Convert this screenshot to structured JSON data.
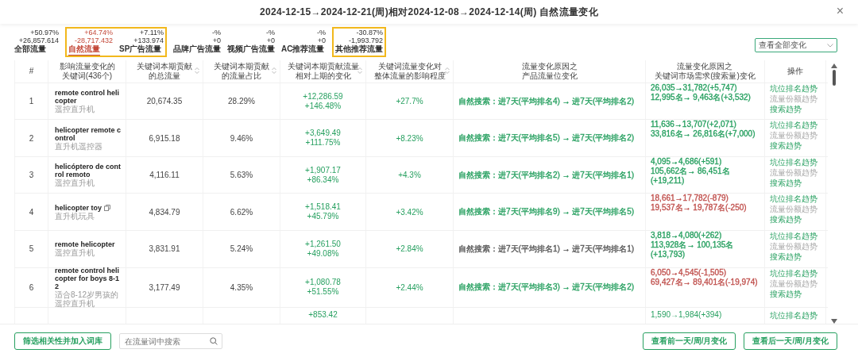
{
  "window": {
    "title": "2024-12-15→2024-12-21(周)相对2024-12-08→2024-12-14(周) 自然流量变化",
    "close": "×"
  },
  "metric_groups": [
    {
      "boxed": false,
      "items": [
        {
          "pct": "+50.97%",
          "abs": "+26,857.614",
          "label": "全部流量",
          "selected": false
        }
      ]
    },
    {
      "boxed": true,
      "items": [
        {
          "pct": "+64.74%",
          "abs": "-28,717.432",
          "label": "自然流量",
          "selected": true
        },
        {
          "pct": "+7.11%",
          "abs": "+133.974",
          "label": "SP广告流量",
          "selected": false
        }
      ]
    },
    {
      "boxed": false,
      "items": [
        {
          "pct": "-%",
          "abs": "+0",
          "label": "品牌广告流量",
          "selected": false
        },
        {
          "pct": "-%",
          "abs": "+0",
          "label": "视频广告流量",
          "selected": false
        },
        {
          "pct": "-%",
          "abs": "+0",
          "label": "AC推荐流量",
          "selected": false
        }
      ]
    },
    {
      "boxed": true,
      "items": [
        {
          "pct": "-30.87%",
          "abs": "-1,993.792",
          "label": "其他推荐流量",
          "selected": false
        }
      ]
    }
  ],
  "filter": {
    "value": "查看全部变化"
  },
  "table": {
    "columns": [
      {
        "lines": [
          "#"
        ],
        "sortable": false
      },
      {
        "lines": [
          "影响流量变化的",
          "关键词(436个)"
        ],
        "sortable": false
      },
      {
        "lines": [
          "关键词本期贡献",
          "的总流量"
        ],
        "sortable": true
      },
      {
        "lines": [
          "关键词本期贡献",
          "的流量占比"
        ],
        "sortable": true
      },
      {
        "lines": [
          "关键词本期贡献流量",
          "相对上期的变化"
        ],
        "sortable": true
      },
      {
        "lines": [
          "关键词流量变化对",
          "整体流量的影响程度"
        ],
        "sortable": true
      },
      {
        "lines": [
          "流量变化原因之",
          "产品流量位变化"
        ],
        "sortable": false
      },
      {
        "lines": [
          "流量变化原因之",
          "关键词市场需求(搜索量)变化"
        ],
        "sortable": false
      },
      {
        "lines": [
          "操作"
        ],
        "sortable": false
      }
    ],
    "rows": [
      {
        "index": "1",
        "keyword": "remote control helicopter",
        "translation": "遥控直升机",
        "copyable": false,
        "total": "20,674.35",
        "share": "28.29%",
        "change": "+12,286.59",
        "change_pct": "+146.48%",
        "impact": "+27.7%",
        "position": {
          "text": "自然搜索：进7天(平均排名4) → 进7天(平均排名2)",
          "color": "#27a060"
        },
        "market": {
          "lines": [
            "26,035→31,782(+5,747)",
            "12,995名→ 9,463名(+3,532)"
          ],
          "color": "#27a060"
        },
        "actions": [
          {
            "label": "坑位排名趋势",
            "disabled": false
          },
          {
            "label": "流量份额趋势",
            "disabled": true
          },
          {
            "label": "搜索趋势",
            "disabled": false
          }
        ]
      },
      {
        "index": "2",
        "keyword": "helicopter remote control",
        "translation": "直升机遥控器",
        "copyable": false,
        "total": "6,915.18",
        "share": "9.46%",
        "change": "+3,649.49",
        "change_pct": "+111.75%",
        "impact": "+8.23%",
        "position": {
          "text": "自然搜索：进7天(平均排名5) → 进7天(平均排名2)",
          "color": "#27a060"
        },
        "market": {
          "lines": [
            "11,636→13,707(+2,071)",
            "33,816名→ 26,816名(+7,000)"
          ],
          "color": "#27a060"
        },
        "actions": [
          {
            "label": "坑位排名趋势",
            "disabled": false
          },
          {
            "label": "流量份额趋势",
            "disabled": true
          },
          {
            "label": "搜索趋势",
            "disabled": false
          }
        ]
      },
      {
        "index": "3",
        "keyword": "helicóptero de control remoto",
        "translation": "遥控直升机",
        "copyable": false,
        "total": "4,116.11",
        "share": "5.63%",
        "change": "+1,907.17",
        "change_pct": "+86.34%",
        "impact": "+4.3%",
        "position": {
          "text": "自然搜索：进7天(平均排名2) → 进7天(平均排名1)",
          "color": "#27a060"
        },
        "market": {
          "lines": [
            "4,095→4,686(+591)",
            "105,662名→ 86,451名(+19,211)"
          ],
          "color": "#27a060"
        },
        "actions": [
          {
            "label": "坑位排名趋势",
            "disabled": false
          },
          {
            "label": "流量份额趋势",
            "disabled": true
          },
          {
            "label": "搜索趋势",
            "disabled": false
          }
        ]
      },
      {
        "index": "4",
        "keyword": "helicopter toy",
        "translation": "直升机玩具",
        "copyable": true,
        "total": "4,834.79",
        "share": "6.62%",
        "change": "+1,518.41",
        "change_pct": "+45.79%",
        "impact": "+3.42%",
        "position": {
          "text": "自然搜索：进7天(平均排名9) → 进7天(平均排名5)",
          "color": "#27a060"
        },
        "market": {
          "lines": [
            "18,661→17,782(-879)",
            "19,537名→ 19,787名(-250)"
          ],
          "color": "#c0504d"
        },
        "actions": [
          {
            "label": "坑位排名趋势",
            "disabled": false
          },
          {
            "label": "流量份额趋势",
            "disabled": true
          },
          {
            "label": "搜索趋势",
            "disabled": false
          }
        ]
      },
      {
        "index": "5",
        "keyword": "remote helicopter",
        "translation": "遥控直升机",
        "copyable": false,
        "total": "3,831.91",
        "share": "5.24%",
        "change": "+1,261.50",
        "change_pct": "+49.08%",
        "impact": "+2.84%",
        "position": {
          "text": "自然搜索：进7天(平均排名1) → 进7天(平均排名1)",
          "color": "#555555"
        },
        "market": {
          "lines": [
            "3,818→4,080(+262)",
            "113,928名→ 100,135名(+13,793)"
          ],
          "color": "#27a060"
        },
        "actions": [
          {
            "label": "坑位排名趋势",
            "disabled": false
          },
          {
            "label": "流量份额趋势",
            "disabled": true
          },
          {
            "label": "搜索趋势",
            "disabled": false
          }
        ]
      },
      {
        "index": "6",
        "keyword": "remote control helicopter for boys 8-12",
        "translation": "适合8-12岁男孩的遥控直升机",
        "copyable": false,
        "total": "3,177.49",
        "share": "4.35%",
        "change": "+1,080.78",
        "change_pct": "+51.55%",
        "impact": "+2.44%",
        "position": {
          "text": "自然搜索：进7天(平均排名3) → 进7天(平均排名2)",
          "color": "#27a060"
        },
        "market": {
          "lines": [
            "6,050→4,545(-1,505)",
            "69,427名→ 89,401名(-19,974)"
          ],
          "color": "#c0504d"
        },
        "actions": [
          {
            "label": "坑位排名趋势",
            "disabled": false
          },
          {
            "label": "流量份额趋势",
            "disabled": true
          },
          {
            "label": "搜索趋势",
            "disabled": false
          }
        ]
      }
    ],
    "partial_row": {
      "change": "+853.42",
      "market": {
        "text": "1,590→1,984(+394)",
        "color": "#27a060"
      },
      "action": "坑位排名趋势"
    }
  },
  "footer": {
    "add_button": "筛选相关性并加入词库",
    "search": {
      "placeholder": "在流量词中搜索"
    },
    "buttons": [
      "查看前一天/周/月变化",
      "查看后一天/周/月变化"
    ]
  }
}
